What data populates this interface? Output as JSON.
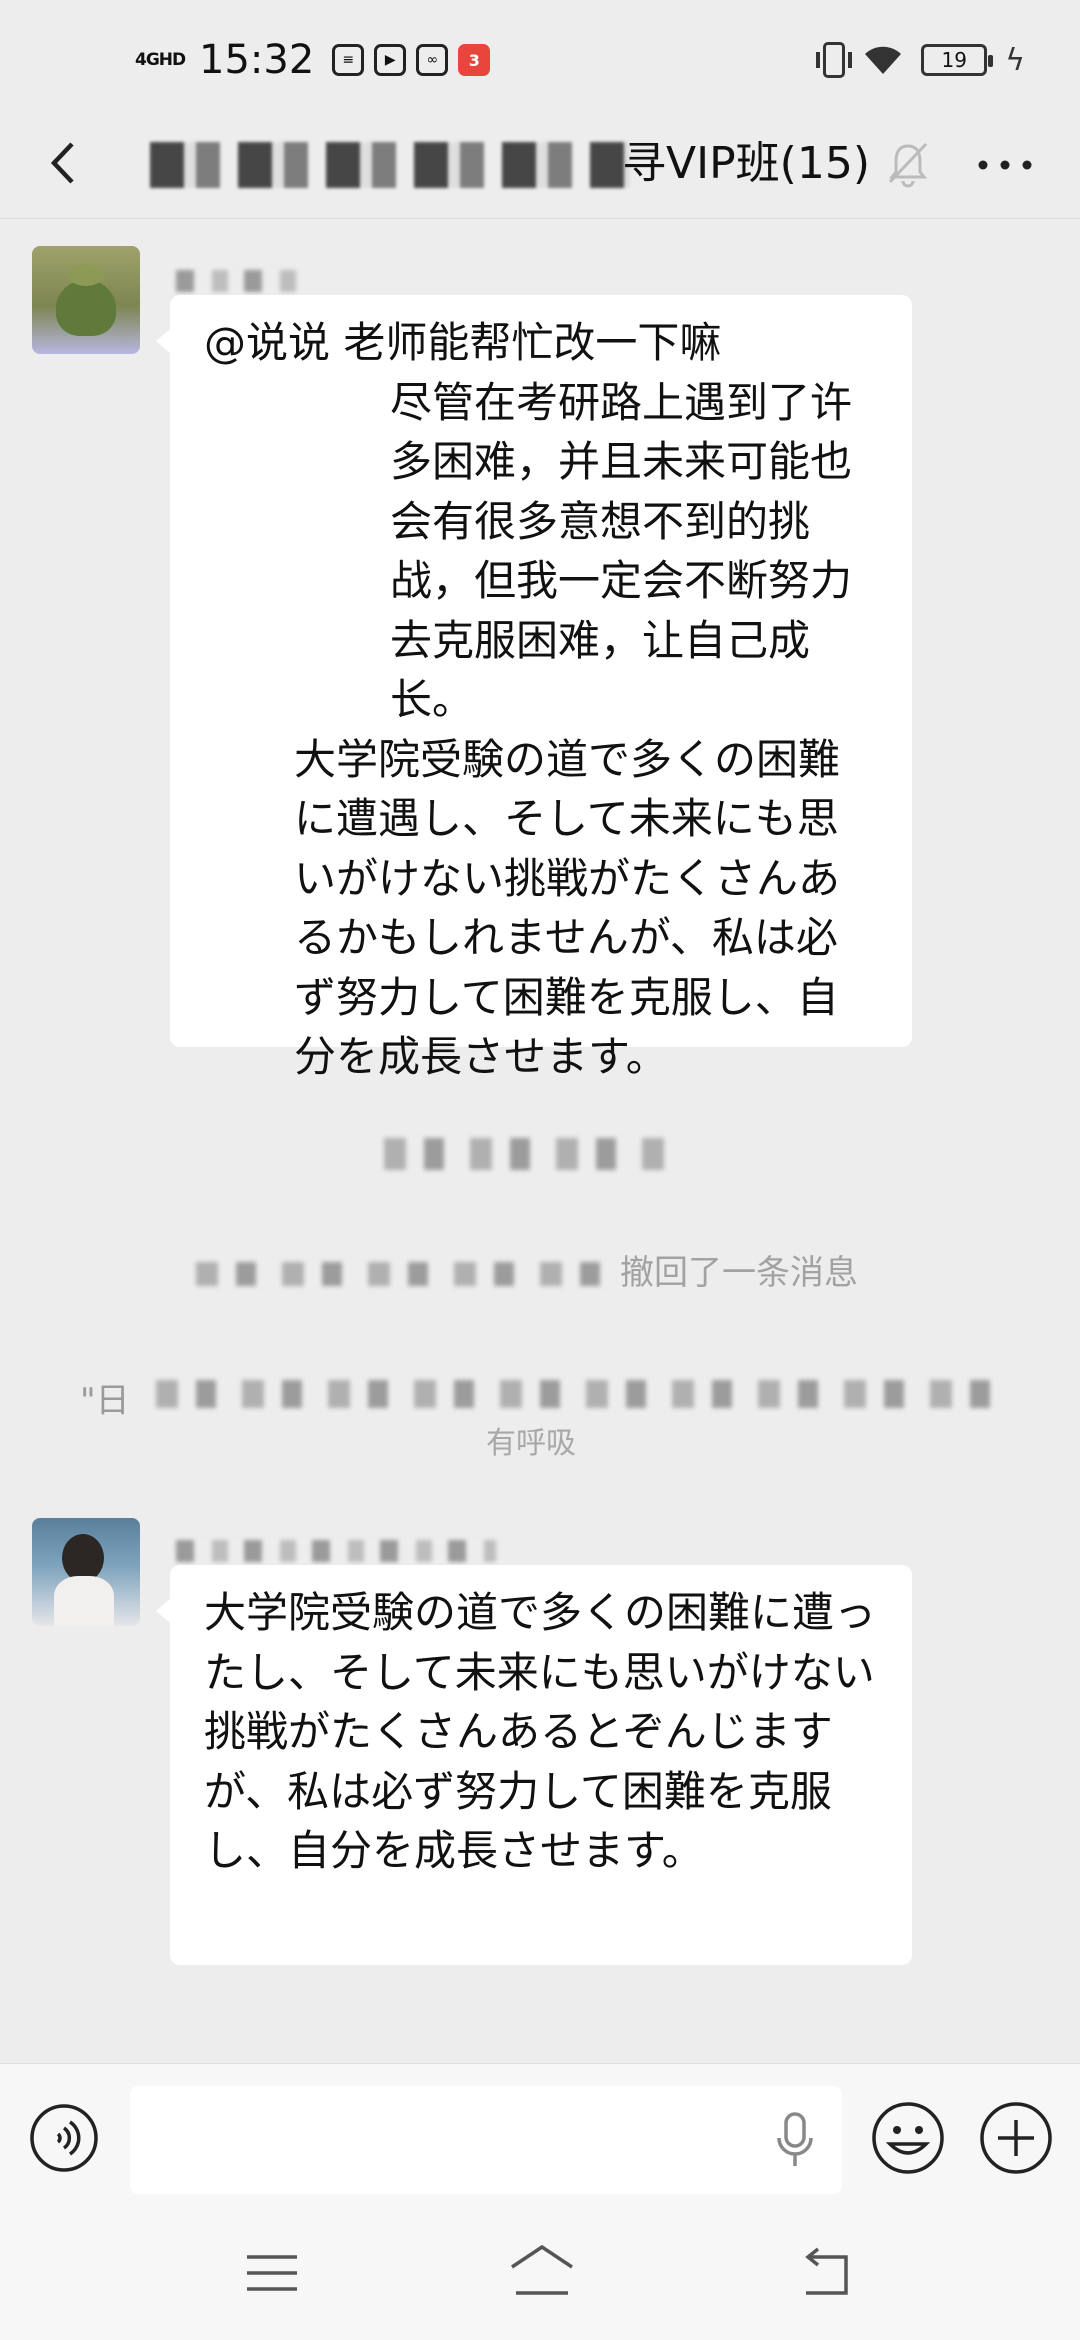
{
  "status_bar": {
    "network": "4GHD",
    "time": "15:32",
    "app_badge": "3",
    "battery": "19"
  },
  "header": {
    "title": "寻VIP班(15)",
    "back_icon": "back-arrow-icon",
    "mute_icon": "bell-muted-icon",
    "more_icon": "more-dots-icon"
  },
  "messages": [
    {
      "sender": "frog-avatar-user",
      "lines": {
        "mention": "@说说 老师能帮忙改一下嘛",
        "zh": "尽管在考研路上遇到了许多困难，并且未来可能也会有很多意想不到的挑战，但我一定会不断努力去克服困难，让自己成长。",
        "ja": "大学院受験の道で多くの困難に遭遇し、そして未来にも思いがけない挑戦がたくさんあるかもしれませんが、私は必ず努力して困難を克服し、自分を成長させます。"
      }
    },
    {
      "sender": "girl-avatar-user",
      "lines": {
        "ja": "大学院受験の道で多くの困難に遭ったし、そして未来にも思いがけない挑戦がたくさんあるとぞんじますが、私は必ず努力して困難を克服し、自分を成長させます。"
      }
    }
  ],
  "system": {
    "recall_notice": "撤回了一条消息",
    "quote_fragment_left": "\"日",
    "breath_text": "有呼吸"
  },
  "input": {
    "placeholder": ""
  },
  "colors": {
    "background": "#ededed",
    "bubble": "#ffffff",
    "system_text": "#9a9a9a"
  }
}
